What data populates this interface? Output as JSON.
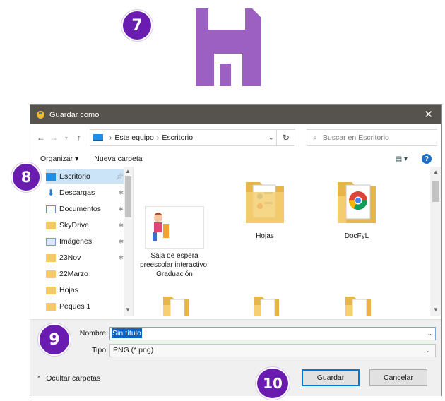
{
  "badges": {
    "b7": "7",
    "b8": "8",
    "b9": "9",
    "b10": "10"
  },
  "colors": {
    "badge": "#6a1cb0",
    "floppy": "#9c5fc2",
    "titlebar": "#56524d",
    "accent": "#0078d7"
  },
  "dialog": {
    "title": "Guardar como",
    "address": {
      "crumb1": "Este equipo",
      "crumb2": "Escritorio"
    },
    "search_placeholder": "Buscar en Escritorio",
    "toolbar": {
      "organize": "Organizar ▾",
      "new_folder": "Nueva carpeta"
    },
    "nav_items": [
      {
        "label": "Escritorio",
        "icon": "desktop-icon"
      },
      {
        "label": "Descargas",
        "icon": "download-icon"
      },
      {
        "label": "Documentos",
        "icon": "documents-icon"
      },
      {
        "label": "SkyDrive",
        "icon": "folder-icon"
      },
      {
        "label": "Imágenes",
        "icon": "pictures-icon"
      },
      {
        "label": "23Nov",
        "icon": "folder-icon"
      },
      {
        "label": "22Marzo",
        "icon": "folder-icon"
      },
      {
        "label": "Hojas",
        "icon": "folder-icon"
      },
      {
        "label": "Peques 1",
        "icon": "folder-icon"
      }
    ],
    "files": [
      {
        "name": "Sala de espera preescolar interactivo. Graduación",
        "icon": "document-thumbnail"
      },
      {
        "name": "Hojas",
        "icon": "folder-icon"
      },
      {
        "name": "DocFyL",
        "icon": "folder-chrome-icon"
      }
    ],
    "filename": {
      "label": "Nombre:",
      "value": "Sin título"
    },
    "filetype": {
      "label": "Tipo:",
      "value": "PNG (*.png)"
    },
    "hide_folders": "Ocultar carpetas",
    "save_label": "Guardar",
    "cancel_label": "Cancelar"
  }
}
